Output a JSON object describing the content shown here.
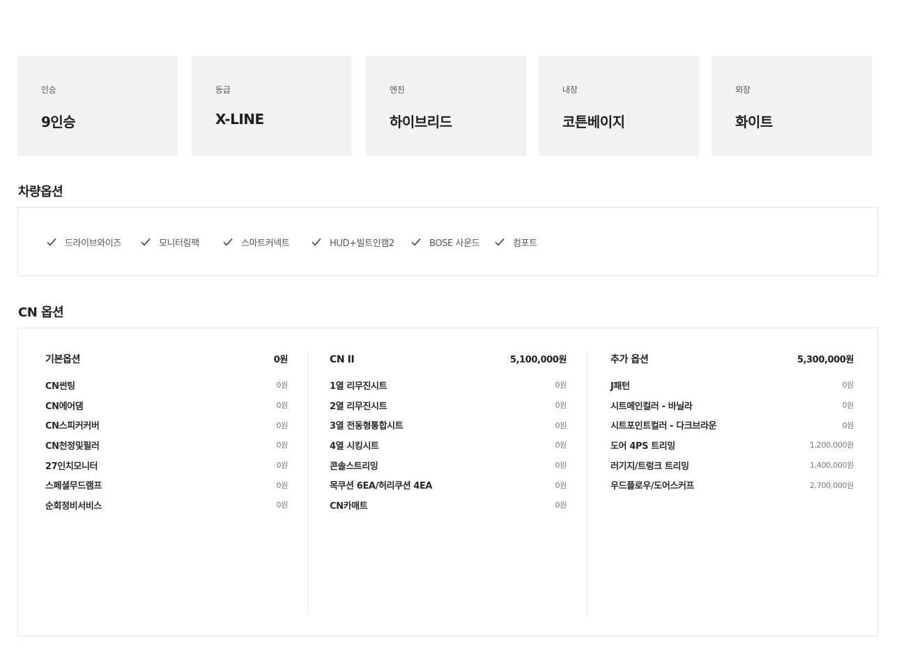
{
  "specs": [
    {
      "label": "인승",
      "value": "9인승"
    },
    {
      "label": "등급",
      "value": "X-LINE"
    },
    {
      "label": "엔진",
      "value": "하이브리드"
    },
    {
      "label": "내장",
      "value": "코튼베이지"
    },
    {
      "label": "외장",
      "value": "화이트"
    }
  ],
  "vehicle_options": {
    "title": "차량옵션",
    "items": [
      "드라이브와이즈",
      "모니터링팩",
      "스마트커넥트",
      "HUD+빌트인캠2",
      "BOSE 사운드",
      "컴포트"
    ]
  },
  "cn_options": {
    "title": "CN 옵션",
    "groups": [
      {
        "title": "기본옵션",
        "price": "0원",
        "items": [
          {
            "name": "CN썬팅",
            "price": "0원"
          },
          {
            "name": "CN에어댐",
            "price": "0원"
          },
          {
            "name": "CN스피커커버",
            "price": "0원"
          },
          {
            "name": "CN천정및필러",
            "price": "0원"
          },
          {
            "name": "27인치모니터",
            "price": "0원"
          },
          {
            "name": "스페셜무드램프",
            "price": "0원"
          },
          {
            "name": "순회정비서비스",
            "price": "0원"
          }
        ]
      },
      {
        "title": "CN II",
        "price": "5,100,000원",
        "items": [
          {
            "name": "1열 리무진시트",
            "price": "0원"
          },
          {
            "name": "2열 리무진시트",
            "price": "0원"
          },
          {
            "name": "3열 전동형통합시트",
            "price": "0원"
          },
          {
            "name": "4열 시킹시트",
            "price": "0원"
          },
          {
            "name": "콘솔스트리밍",
            "price": "0원"
          },
          {
            "name": "목쿠션 6EA/허리쿠션 4EA",
            "price": "0원"
          },
          {
            "name": "CN카매트",
            "price": "0원"
          }
        ]
      },
      {
        "title": "추가 옵션",
        "price": "5,300,000원",
        "items": [
          {
            "name": "J패턴",
            "price": "0원"
          },
          {
            "name": "시트메인컬러 - 바닐라",
            "price": "0원"
          },
          {
            "name": "시트포인트컬러 - 다크브라운",
            "price": "0원"
          },
          {
            "name": "도어 4PS 트리밍",
            "price": "1,200,000원"
          },
          {
            "name": "러기지/트렁크 트리밍",
            "price": "1,400,000원"
          },
          {
            "name": "우드플로우/도어스커프",
            "price": "2,700,000원"
          }
        ]
      }
    ]
  }
}
